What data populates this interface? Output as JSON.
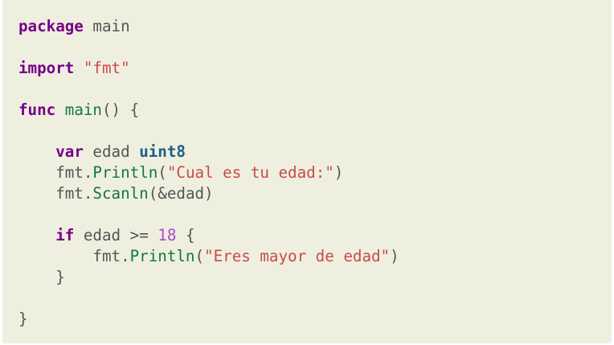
{
  "code": {
    "language": "go",
    "lines": [
      [
        {
          "t": "package",
          "c": "kw"
        },
        {
          "t": " main",
          "c": "plain"
        }
      ],
      [],
      [
        {
          "t": "import",
          "c": "kw"
        },
        {
          "t": " ",
          "c": "plain"
        },
        {
          "t": "\"fmt\"",
          "c": "str"
        }
      ],
      [],
      [
        {
          "t": "func",
          "c": "kw"
        },
        {
          "t": " ",
          "c": "plain"
        },
        {
          "t": "main",
          "c": "def"
        },
        {
          "t": "() {",
          "c": "plain"
        }
      ],
      [],
      [
        {
          "t": "    ",
          "c": "plain"
        },
        {
          "t": "var",
          "c": "kw"
        },
        {
          "t": " edad ",
          "c": "plain"
        },
        {
          "t": "uint8",
          "c": "type"
        }
      ],
      [
        {
          "t": "    fmt.",
          "c": "plain"
        },
        {
          "t": "Println",
          "c": "def"
        },
        {
          "t": "(",
          "c": "plain"
        },
        {
          "t": "\"Cual es tu edad:\"",
          "c": "str"
        },
        {
          "t": ")",
          "c": "plain"
        }
      ],
      [
        {
          "t": "    fmt.",
          "c": "plain"
        },
        {
          "t": "Scanln",
          "c": "def"
        },
        {
          "t": "(&edad)",
          "c": "plain"
        }
      ],
      [],
      [
        {
          "t": "    ",
          "c": "plain"
        },
        {
          "t": "if",
          "c": "kw"
        },
        {
          "t": " edad >= ",
          "c": "plain"
        },
        {
          "t": "18",
          "c": "num"
        },
        {
          "t": " {",
          "c": "plain"
        }
      ],
      [
        {
          "t": "        fmt.",
          "c": "plain"
        },
        {
          "t": "Println",
          "c": "def"
        },
        {
          "t": "(",
          "c": "plain"
        },
        {
          "t": "\"Eres mayor de edad\"",
          "c": "str"
        },
        {
          "t": ")",
          "c": "plain"
        }
      ],
      [
        {
          "t": "    }",
          "c": "plain"
        }
      ],
      [],
      [
        {
          "t": "}",
          "c": "plain"
        }
      ]
    ]
  },
  "colors": {
    "background": "#efefdf",
    "keyword": "#770088",
    "type": "#1a5e8a",
    "function": "#117a3a",
    "string": "#c94a4a",
    "number": "#a84fc8",
    "plain": "#555555"
  }
}
